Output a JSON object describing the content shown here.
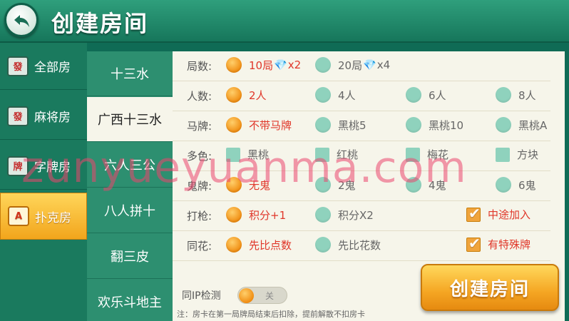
{
  "header": {
    "title": "创建房间"
  },
  "categories": [
    {
      "label": "全部房",
      "icon": "發"
    },
    {
      "label": "麻将房",
      "icon": "發"
    },
    {
      "label": "字牌房",
      "icon": "牌"
    },
    {
      "label": "扑克房",
      "icon": "A"
    }
  ],
  "games": [
    "十三水",
    "广西十三水",
    "六人三公",
    "八人拼十",
    "翻三皮",
    "欢乐斗地主"
  ],
  "rows": {
    "rounds": {
      "label": "局数:",
      "opt1": "10局",
      "opt1_mult": "x2",
      "opt2": "20局",
      "opt2_mult": "x4"
    },
    "players": {
      "label": "人数:",
      "opts": [
        "2人",
        "4人",
        "6人",
        "8人"
      ]
    },
    "horse": {
      "label": "马牌:",
      "opts": [
        "不带马牌",
        "黑桃5",
        "黑桃10",
        "黑桃A"
      ]
    },
    "multicolor": {
      "label": "多色:",
      "opts": [
        "黑桃",
        "红桃",
        "梅花",
        "方块"
      ]
    },
    "ghost": {
      "label": "鬼牌:",
      "opts": [
        "无鬼",
        "2鬼",
        "4鬼",
        "6鬼"
      ]
    },
    "shoot": {
      "label": "打枪:",
      "opts": [
        "积分+1",
        "积分X2"
      ],
      "check": "中途加入"
    },
    "flush": {
      "label": "同花:",
      "opts": [
        "先比点数",
        "先比花数"
      ],
      "check": "有特殊牌"
    }
  },
  "ip_check": {
    "label": "同IP检测",
    "state": "关"
  },
  "note": "注：房卡在第一局牌局结束后扣除，提前解散不扣房卡",
  "create_button": "创建房间",
  "watermark": "zunyueyuanma.com"
}
